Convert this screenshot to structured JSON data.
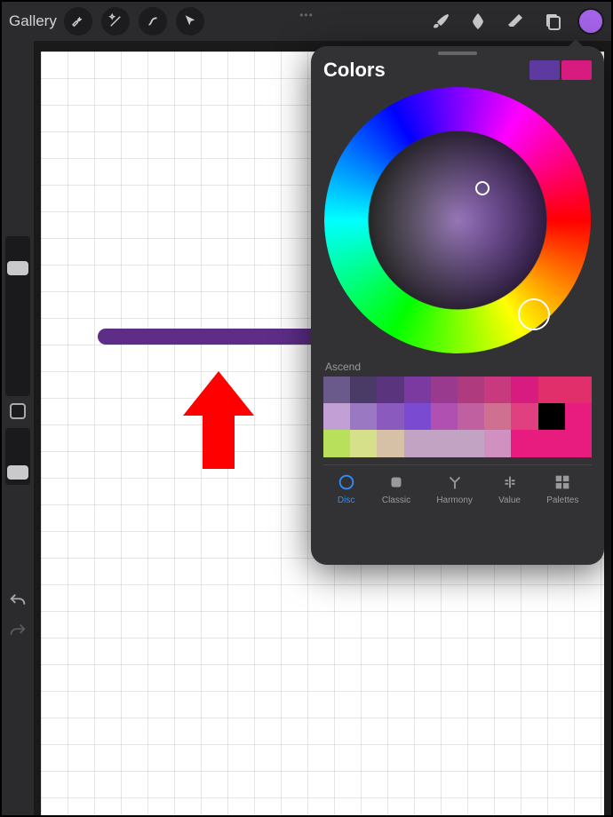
{
  "topbar": {
    "gallery_label": "Gallery",
    "left_icons": [
      "wrench-icon",
      "wand-icon",
      "s-curve-icon",
      "cursor-icon"
    ],
    "right_icons": [
      "brush-icon",
      "smudge-icon",
      "eraser-icon",
      "layers-icon"
    ],
    "more_indicator": "•••",
    "current_color": "#a463e8"
  },
  "sidebar": {
    "undo": "undo-icon",
    "redo": "redo-icon"
  },
  "canvas": {
    "stroke_color": "#5d2d88",
    "annotation_arrow_color": "#ff0000"
  },
  "color_panel": {
    "title": "Colors",
    "primary_swatch": "#5d3aa0",
    "secondary_swatch": "#d81b7e",
    "palette_label": "Ascend",
    "palette_colors": [
      "#6a5a8c",
      "#4a3b66",
      "#5a357e",
      "#7a3aa0",
      "#9a3a8e",
      "#b03a7e",
      "#c73a7e",
      "#d81b7e",
      "#e02f6a",
      "#e02f6a",
      "#c2a0d6",
      "#9a78c2",
      "#8a5abf",
      "#7a4ad0",
      "#b050b0",
      "#c060a0",
      "#d07090",
      "#e04080",
      "#000000",
      "#e81b7e",
      "#b8e05a",
      "#d6e08a",
      "#d6c0a6",
      "#c3a3c3",
      "#c3a3c3",
      "#c3a3c3",
      "#d090c0",
      "#e81b7e",
      "#e81b7e",
      "#e81b7e"
    ],
    "tabs": [
      {
        "id": "disc",
        "label": "Disc",
        "active": true
      },
      {
        "id": "classic",
        "label": "Classic",
        "active": false
      },
      {
        "id": "harmony",
        "label": "Harmony",
        "active": false
      },
      {
        "id": "value",
        "label": "Value",
        "active": false
      },
      {
        "id": "palettes",
        "label": "Palettes",
        "active": false
      }
    ]
  }
}
